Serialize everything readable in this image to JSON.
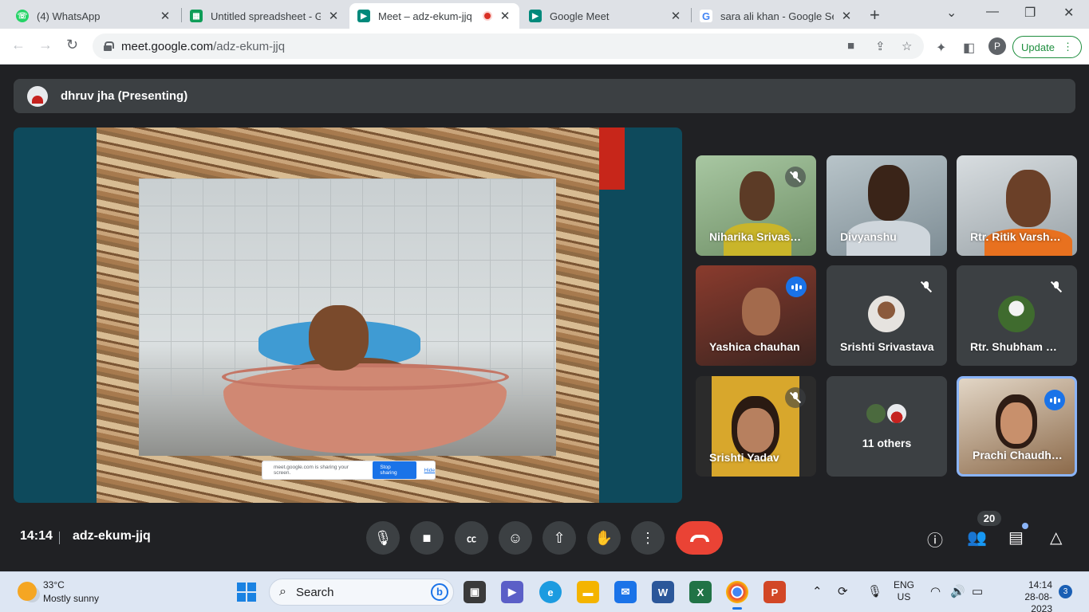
{
  "browser": {
    "tabs": [
      {
        "title": "(4) WhatsApp",
        "favicon": "whatsapp-icon",
        "color": "#25d366"
      },
      {
        "title": "Untitled spreadsheet - Go",
        "favicon": "sheets-icon",
        "color": "#0f9d58"
      },
      {
        "title": "Meet – adz-ekum-jjq",
        "favicon": "meet-icon",
        "color": "#00897b",
        "active": true,
        "recording": true
      },
      {
        "title": "Google Meet",
        "favicon": "meet-icon",
        "color": "#00897b"
      },
      {
        "title": "sara ali khan - Google Se",
        "favicon": "google-icon",
        "color": "#4285f4"
      }
    ],
    "url_host": "meet.google.com",
    "url_path": "/adz-ekum-jjq",
    "profile_initial": "P",
    "update_label": "Update"
  },
  "meeting": {
    "presenter": "dhruv jha (Presenting)",
    "share_banner": {
      "text": "meet.google.com is sharing your screen.",
      "stop": "Stop sharing",
      "hide": "Hide"
    },
    "participants": [
      "Niharika Srivastava",
      "Divyanshu",
      "Rtr. Ritik Varshney",
      "Yashica chauhan",
      "Srishti Srivastava",
      "Rtr. Shubham Singh",
      "Srishti Yadav",
      "11 others",
      "Prachi Chaudhary"
    ],
    "time": "14:14",
    "code": "adz-ekum-jjq",
    "participant_count": "20"
  },
  "taskbar": {
    "temperature": "33°C",
    "weather": "Mostly sunny",
    "search": "Search",
    "lang_1": "ENG",
    "lang_2": "US",
    "time": "14:14",
    "date": "28-08-2023",
    "notifications": "3"
  }
}
